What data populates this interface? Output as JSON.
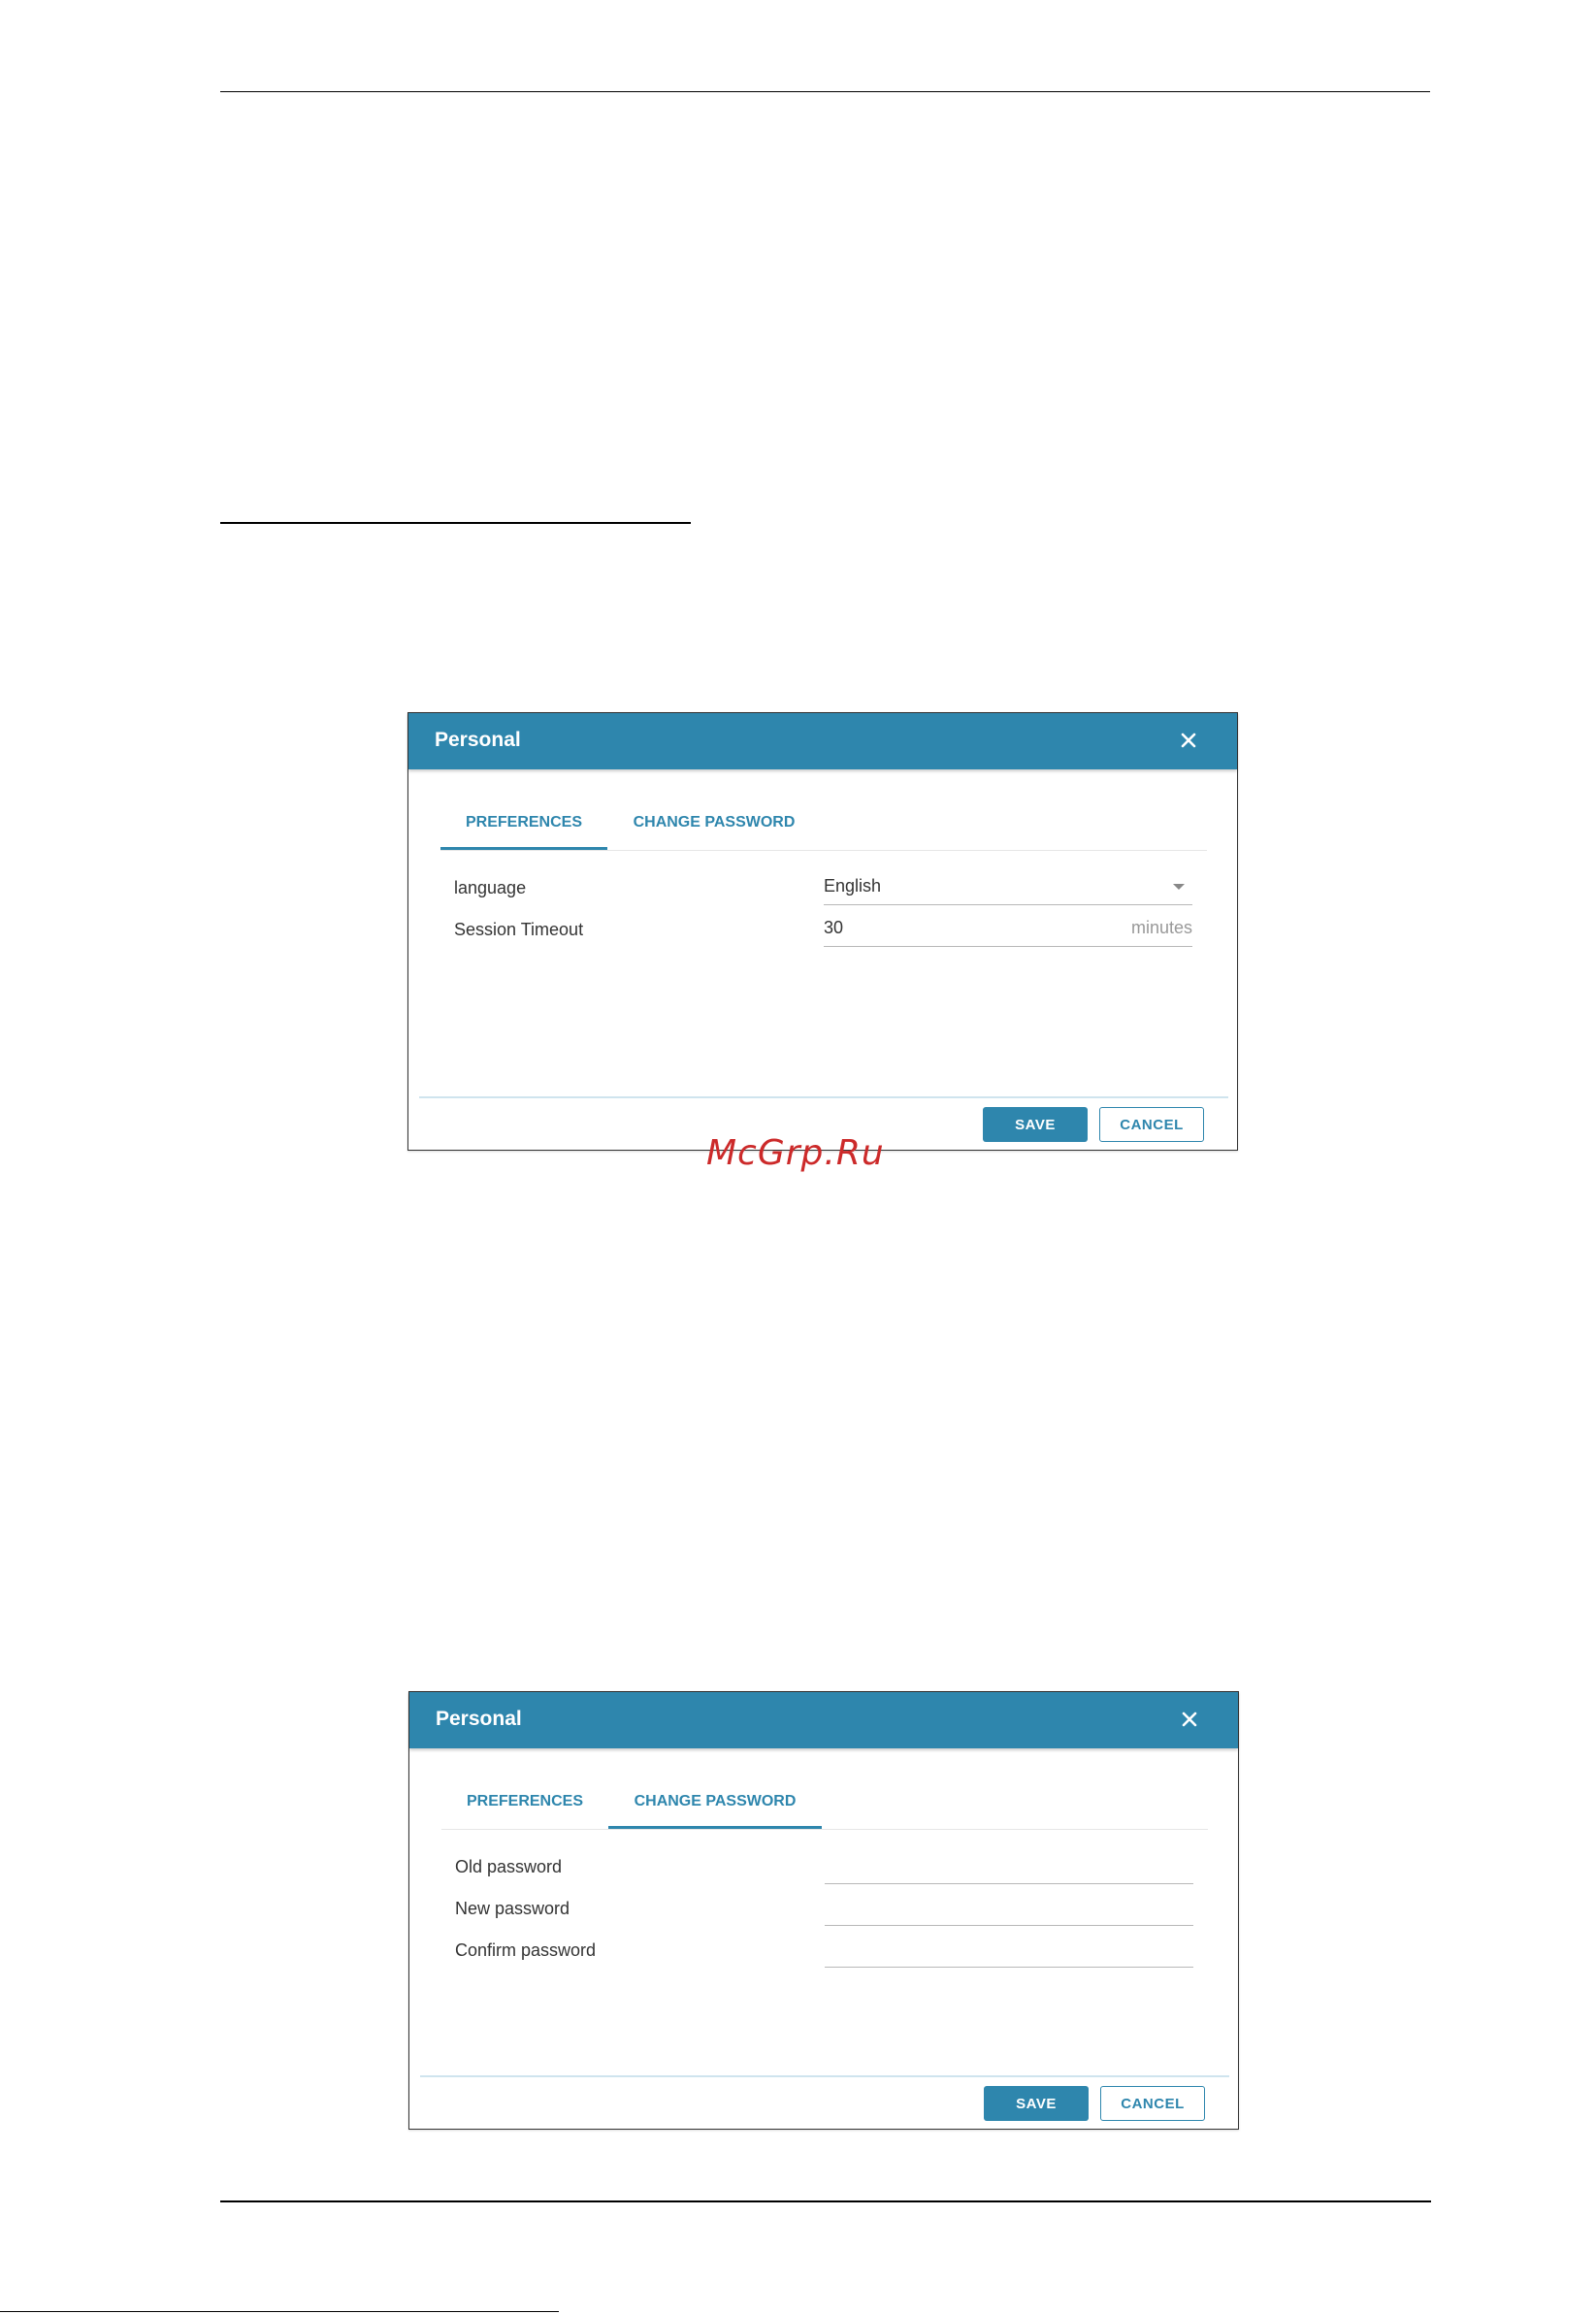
{
  "watermark": "McGrp.Ru",
  "dialogs": [
    {
      "title": "Personal",
      "tabs": {
        "preferences": "PREFERENCES",
        "change_password": "CHANGE PASSWORD"
      },
      "active_tab": "preferences",
      "fields": {
        "language_label": "language",
        "language_value": "English",
        "timeout_label": "Session Timeout",
        "timeout_value": "30",
        "timeout_unit": "minutes"
      },
      "buttons": {
        "save": "SAVE",
        "cancel": "CANCEL"
      }
    },
    {
      "title": "Personal",
      "tabs": {
        "preferences": "PREFERENCES",
        "change_password": "CHANGE PASSWORD"
      },
      "active_tab": "change_password",
      "fields": {
        "old_password_label": "Old password",
        "new_password_label": "New password",
        "confirm_password_label": "Confirm password"
      },
      "buttons": {
        "save": "SAVE",
        "cancel": "CANCEL"
      }
    }
  ],
  "colors": {
    "accent": "#2e86ad",
    "watermark": "#cc2a2a",
    "text": "#333333",
    "muted": "#999999"
  }
}
